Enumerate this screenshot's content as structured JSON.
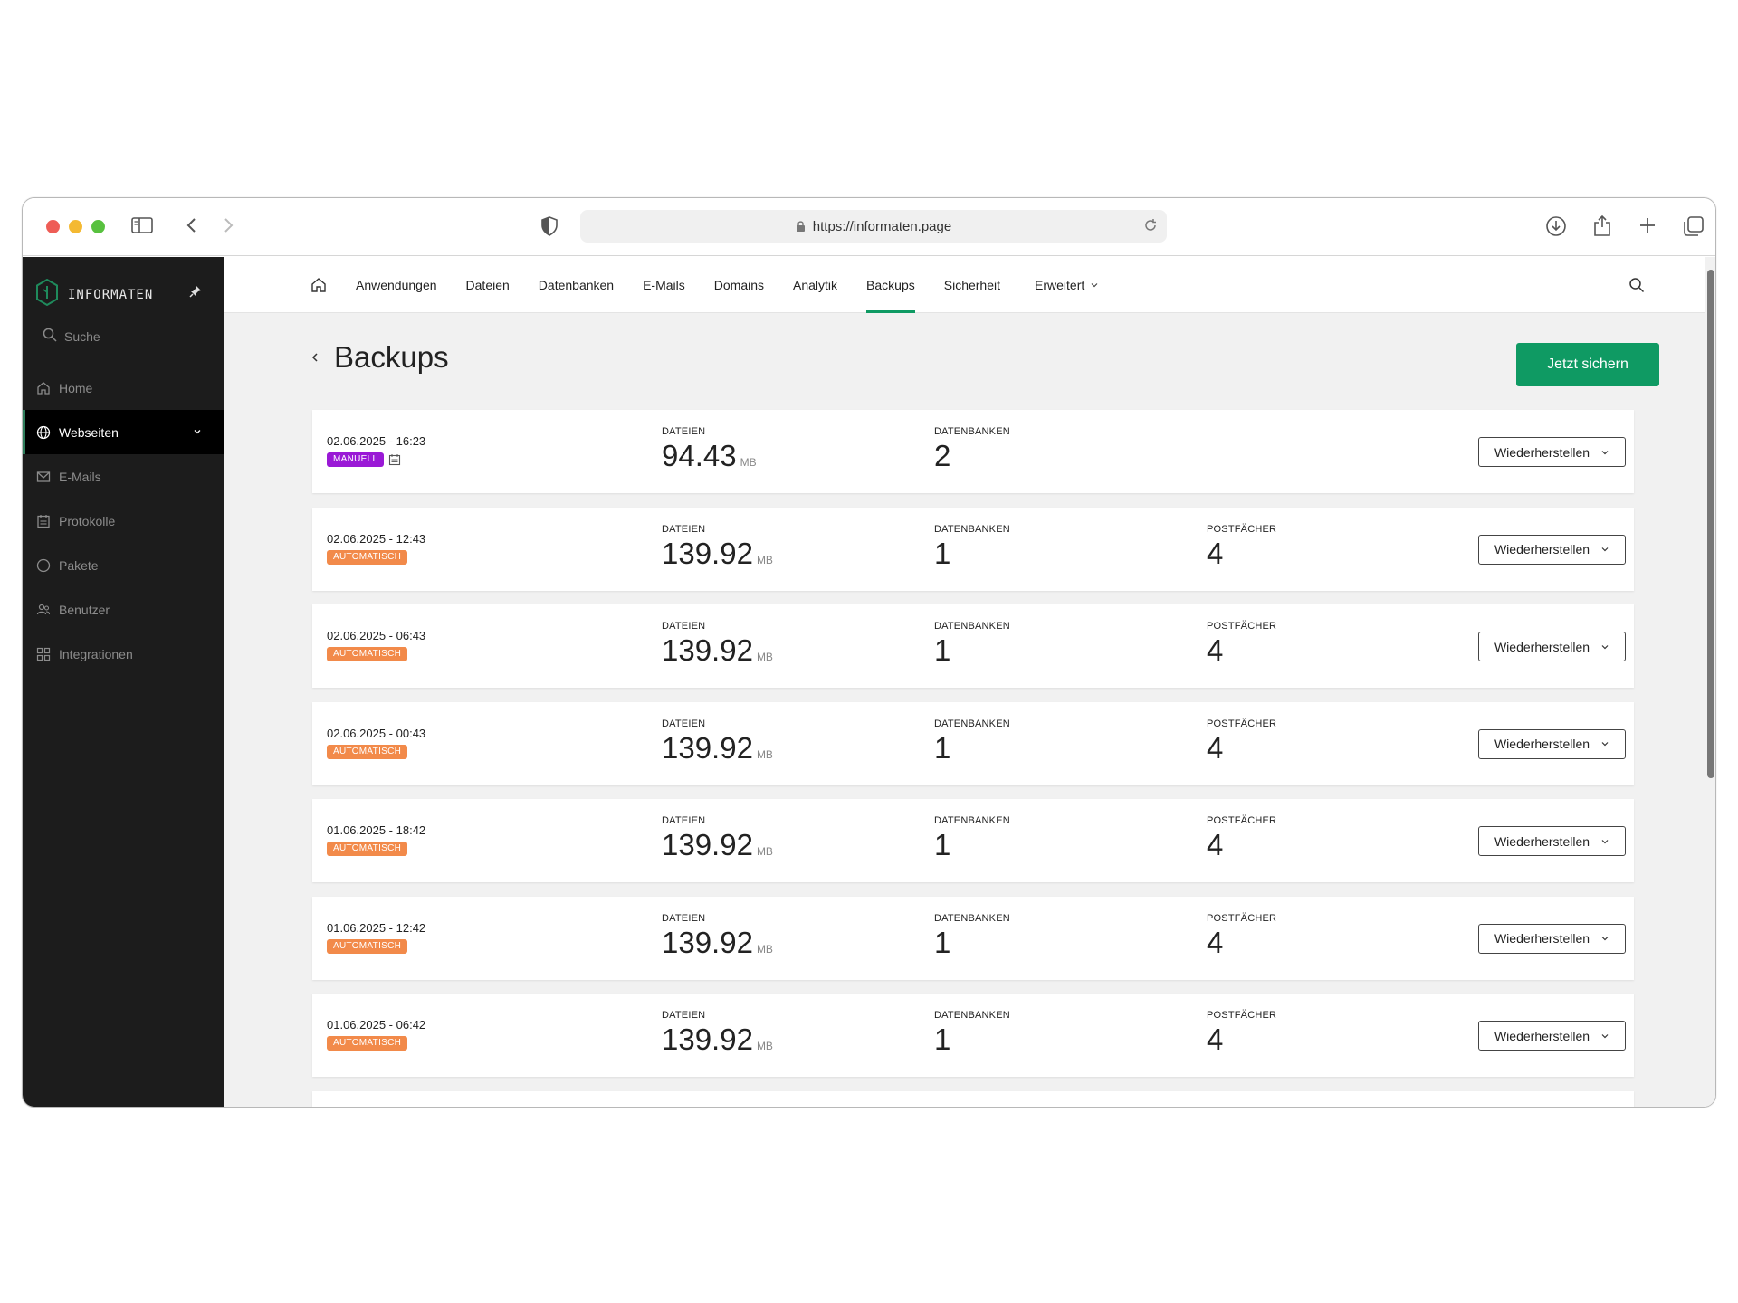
{
  "browser": {
    "url": "https://informaten.page"
  },
  "sidebar": {
    "brand": "INFORMATEN",
    "search_label": "Suche",
    "items": [
      {
        "label": "Home",
        "icon": "home-icon"
      },
      {
        "label": "Webseiten",
        "icon": "globe-icon",
        "active": true
      },
      {
        "label": "E-Mails",
        "icon": "mail-icon"
      },
      {
        "label": "Protokolle",
        "icon": "log-icon"
      },
      {
        "label": "Pakete",
        "icon": "package-icon"
      },
      {
        "label": "Benutzer",
        "icon": "users-icon"
      },
      {
        "label": "Integrationen",
        "icon": "grid-icon"
      }
    ]
  },
  "topnav": {
    "tabs": [
      {
        "label": "Anwendungen"
      },
      {
        "label": "Dateien"
      },
      {
        "label": "Datenbanken"
      },
      {
        "label": "E-Mails"
      },
      {
        "label": "Domains"
      },
      {
        "label": "Analytik"
      },
      {
        "label": "Backups",
        "active": true
      },
      {
        "label": "Sicherheit"
      },
      {
        "label": "Erweitert",
        "dropdown": true
      }
    ]
  },
  "page": {
    "title": "Backups",
    "primary_button": "Jetzt sichern"
  },
  "labels": {
    "files": "DATEIEN",
    "databases": "DATENBANKEN",
    "mailboxes": "POSTFÄCHER",
    "unit": "MB",
    "restore": "Wiederherstellen"
  },
  "backups": [
    {
      "datetime": "02.06.2025 - 16:23",
      "type": "MANUELL",
      "files": "94.43",
      "databases": "2",
      "mailboxes": null
    },
    {
      "datetime": "02.06.2025 - 12:43",
      "type": "AUTOMATISCH",
      "files": "139.92",
      "databases": "1",
      "mailboxes": "4"
    },
    {
      "datetime": "02.06.2025 - 06:43",
      "type": "AUTOMATISCH",
      "files": "139.92",
      "databases": "1",
      "mailboxes": "4"
    },
    {
      "datetime": "02.06.2025 - 00:43",
      "type": "AUTOMATISCH",
      "files": "139.92",
      "databases": "1",
      "mailboxes": "4"
    },
    {
      "datetime": "01.06.2025 - 18:42",
      "type": "AUTOMATISCH",
      "files": "139.92",
      "databases": "1",
      "mailboxes": "4"
    },
    {
      "datetime": "01.06.2025 - 12:42",
      "type": "AUTOMATISCH",
      "files": "139.92",
      "databases": "1",
      "mailboxes": "4"
    },
    {
      "datetime": "01.06.2025 - 06:42",
      "type": "AUTOMATISCH",
      "files": "139.92",
      "databases": "1",
      "mailboxes": "4"
    }
  ],
  "colors": {
    "accent": "#0f9a63",
    "sidebar_bg": "#1c1c1c",
    "badge_manual": "#9a19d6",
    "badge_auto": "#f28a4a"
  }
}
